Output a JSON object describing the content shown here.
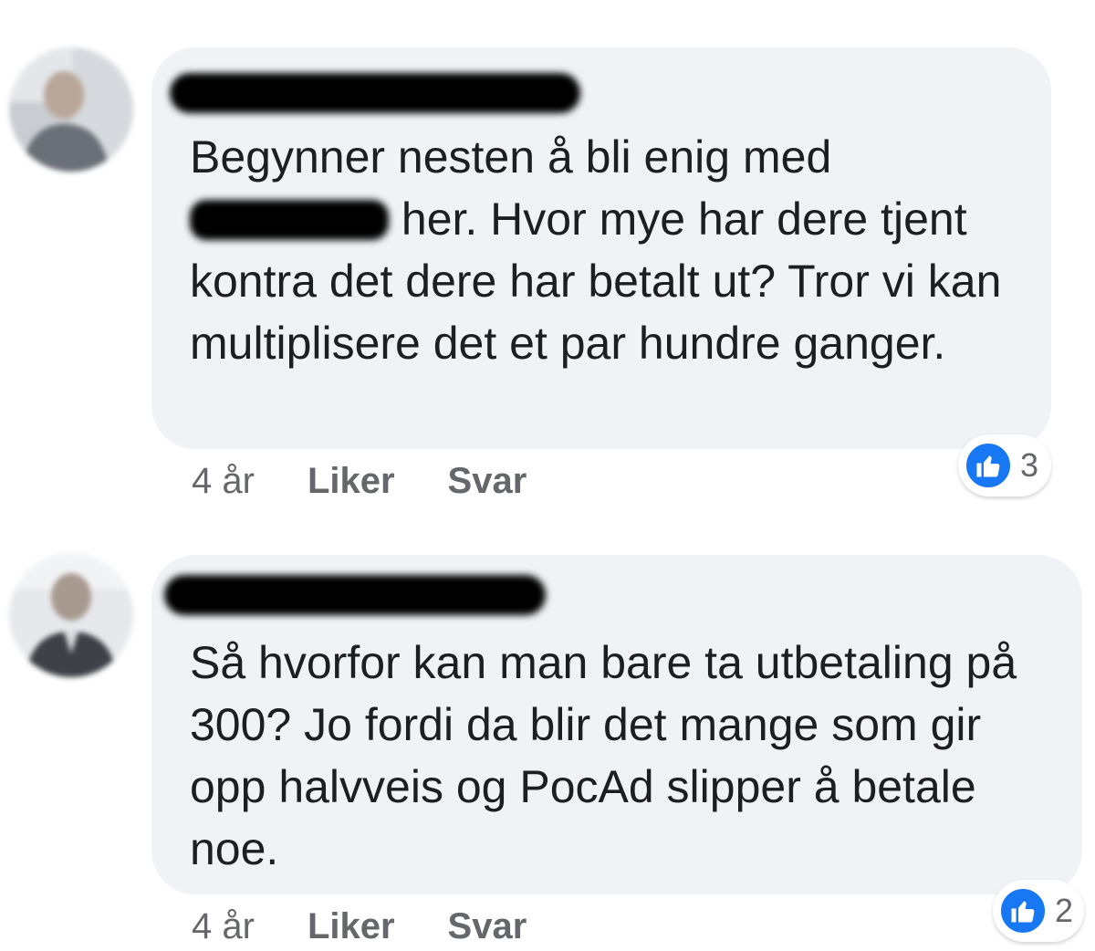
{
  "comments": [
    {
      "text_before_mention": "Begynner nesten å bli enig med",
      "text_after_mention": " her. Hvor mye har dere tjent kontra det dere har betalt ut? Tror vi kan multiplisere det et par hundre ganger.",
      "time": "4 år",
      "like_label": "Liker",
      "reply_label": "Svar",
      "reaction_count": "3"
    },
    {
      "text": "Så hvorfor kan man bare ta utbetaling på 300? Jo fordi da blir det mange som gir opp halvveis og PocAd slipper å betale noe.",
      "time": "4 år",
      "like_label": "Liker",
      "reply_label": "Svar",
      "reaction_count": "2"
    }
  ],
  "colors": {
    "bubble": "#f0f2f5",
    "meta_text": "#65676b",
    "like_blue": "#1877f2"
  },
  "icons": {
    "reaction": "thumbs-up-icon"
  }
}
